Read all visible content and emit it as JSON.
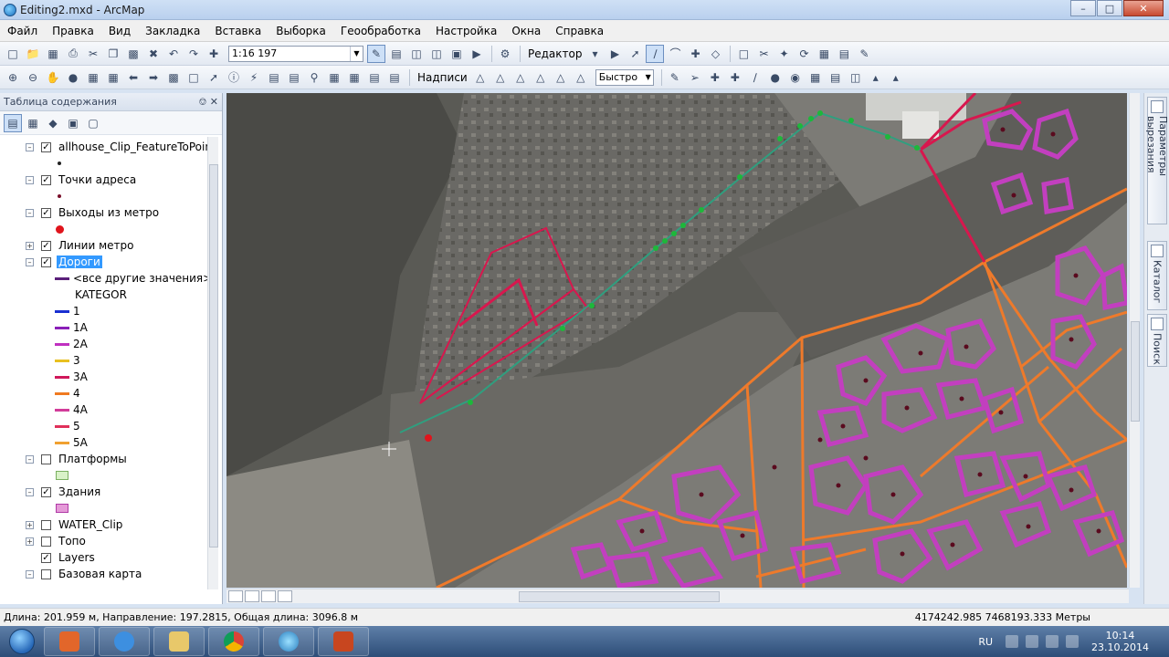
{
  "window": {
    "title": "Editing2.mxd - ArcMap"
  },
  "menu": [
    "Файл",
    "Правка",
    "Вид",
    "Закладка",
    "Вставка",
    "Выборка",
    "Геообработка",
    "Настройка",
    "Окна",
    "Справка"
  ],
  "toolbar": {
    "scale": "1:16 197",
    "editor_label": "Редактор",
    "labels_label": "Надписи",
    "draw_mode": "Быстро"
  },
  "toc": {
    "title": "Таблица содержания",
    "layers": [
      {
        "name": "allhouse_Clip_FeatureToPoint1",
        "checked": true
      },
      {
        "name": "Точки адреса",
        "checked": true
      },
      {
        "name": "Выходы из метро",
        "checked": true
      },
      {
        "name": "Линии метро",
        "checked": true
      },
      {
        "name": "Дороги",
        "checked": true
      },
      {
        "name": "Платформы",
        "checked": false
      },
      {
        "name": "Здания",
        "checked": true
      },
      {
        "name": "WATER_Clip",
        "checked": false
      },
      {
        "name": "Топо",
        "checked": false
      },
      {
        "name": "Layers",
        "checked": true
      },
      {
        "name": "Базовая карта",
        "checked": false
      }
    ],
    "roads_legend": {
      "other_values": "<все другие значения>",
      "field": "KATEGOR",
      "categories": [
        {
          "label": "1",
          "color": "#1a2fd1"
        },
        {
          "label": "1A",
          "color": "#8a1fb8"
        },
        {
          "label": "2A",
          "color": "#c030c0"
        },
        {
          "label": "3",
          "color": "#e8c020"
        },
        {
          "label": "3A",
          "color": "#d0185a"
        },
        {
          "label": "4",
          "color": "#f07a20"
        },
        {
          "label": "4A",
          "color": "#d23c9a"
        },
        {
          "label": "5",
          "color": "#e0305a"
        },
        {
          "label": "5A",
          "color": "#f0a030"
        }
      ]
    }
  },
  "dock_tabs": [
    "Параметры вырезания",
    "Каталог",
    "Поиск"
  ],
  "status": {
    "left": "Длина: 201.959 м, Направление: 197.2815, Общая длина: 3096.8 м",
    "coords": "4174242.985  7468193.333 Метры"
  },
  "taskbar": {
    "lang": "RU",
    "time": "10:14",
    "date": "23.10.2014"
  },
  "colors": {
    "roads_orange": "#ee7a2b",
    "roads_red": "#d8174e",
    "buildings": "#c23fbf",
    "metro_line": "#2f9f7f"
  }
}
